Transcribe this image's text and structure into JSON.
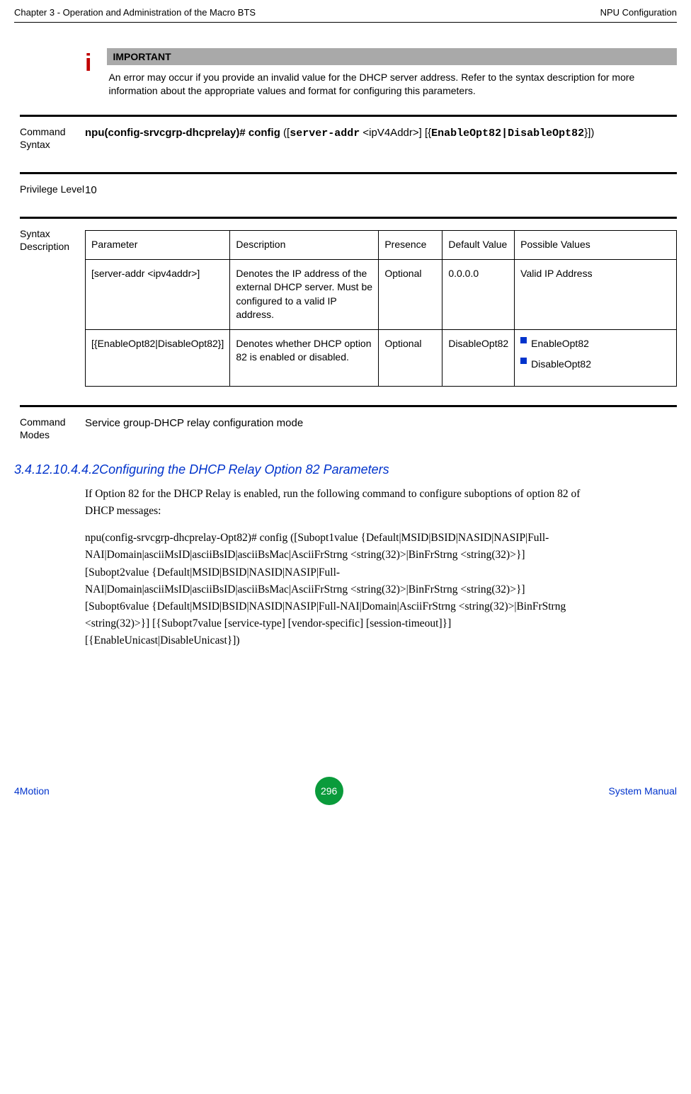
{
  "header": {
    "left": "Chapter 3 - Operation and Administration of the Macro BTS",
    "right": "NPU Configuration"
  },
  "important": {
    "label": "IMPORTANT",
    "text": "An error may occur if you provide an invalid value for the DHCP server address. Refer to the syntax description for more information about the appropriate values and format for configuring this parameters."
  },
  "command_syntax": {
    "label": "Command Syntax",
    "prefix": "npu(config-srvcgrp-dhcprelay)# config",
    "open": " ([",
    "mono1": "server-addr",
    "mid": " <ipV4Addr>] [{",
    "mono2": "EnableOpt82|DisableOpt82",
    "end": "}])"
  },
  "privilege": {
    "label": "Privilege Level",
    "value": "10"
  },
  "syntax_desc": {
    "label": "Syntax Description",
    "headers": [
      "Parameter",
      "Description",
      "Presence",
      "Default Value",
      "Possible Values"
    ],
    "rows": [
      {
        "param": "[server-addr <ipv4addr>]",
        "desc": "Denotes the IP address of the external DHCP server. Must be configured to a valid IP address.",
        "presence": "Optional",
        "default": "0.0.0.0",
        "possible_plain": "Valid IP Address"
      },
      {
        "param": "[{EnableOpt82|DisableOpt82}]",
        "desc": "Denotes whether DHCP option 82 is enabled or disabled.",
        "presence": "Optional",
        "default": "DisableOpt82",
        "possible_list": [
          "EnableOpt82",
          "DisableOpt82"
        ]
      }
    ]
  },
  "command_modes": {
    "label": "Command Modes",
    "value": "Service group-DHCP relay configuration mode"
  },
  "heading": {
    "num": "3.4.12.10.4.4.2",
    "title": "Configuring the DHCP Relay Option 82 Parameters"
  },
  "paragraph1": "If Option 82 for the DHCP Relay is enabled, run the following command to configure suboptions of option 82 of DHCP messages:",
  "paragraph2": "npu(config-srvcgrp-dhcprelay-Opt82)# config ([Subopt1value {Default|MSID|BSID|NASID|NASIP|Full-NAI|Domain|asciiMsID|asciiBsID|asciiBsMac|AsciiFrStrng <string(32)>|BinFrStrng <string(32)>}] [Subopt2value {Default|MSID|BSID|NASID|NASIP|Full-NAI|Domain|asciiMsID|asciiBsID|asciiBsMac|AsciiFrStrng <string(32)>|BinFrStrng <string(32)>}] [Subopt6value {Default|MSID|BSID|NASID|NASIP|Full-NAI|Domain|AsciiFrStrng <string(32)>|BinFrStrng <string(32)>}] [{Subopt7value [service-type] [vendor-specific] [session-timeout]}] [{EnableUnicast|DisableUnicast}])",
  "footer": {
    "left": "4Motion",
    "page": "296",
    "right": "System Manual"
  }
}
